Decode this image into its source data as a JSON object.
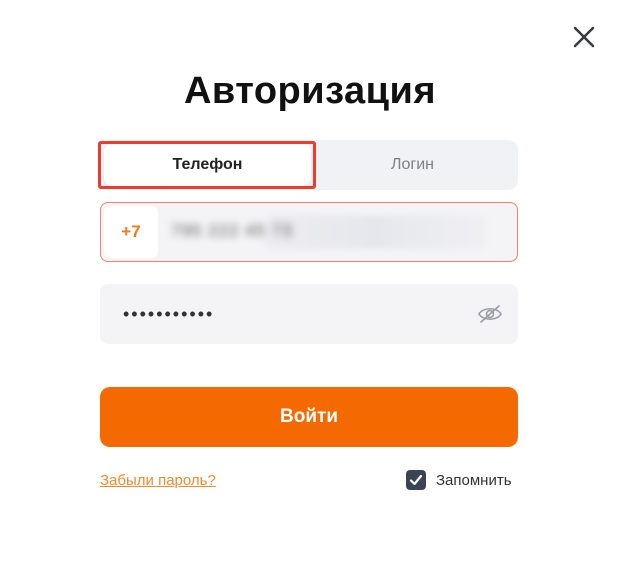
{
  "dialog": {
    "title": "Авторизация",
    "tabs": [
      {
        "label": "Телефон",
        "active": true
      },
      {
        "label": "Логин",
        "active": false
      }
    ],
    "phone": {
      "prefix": "+7",
      "value": "795 222 45 73",
      "masked": true
    },
    "password": {
      "value": "•••••••••••"
    },
    "login_button": "Войти",
    "forgot_link": "Забыли пароль?",
    "remember_label": "Запомнить",
    "remember_checked": true
  },
  "colors": {
    "accent": "#f56a00",
    "highlight": "#ec3b2f",
    "link": "#f08a2c",
    "tab_bg": "#f1f2f5",
    "field_bg": "#f4f4f6"
  },
  "icons": {
    "close": "close-icon",
    "eye": "eye-off-icon",
    "checkbox": "check-icon"
  }
}
